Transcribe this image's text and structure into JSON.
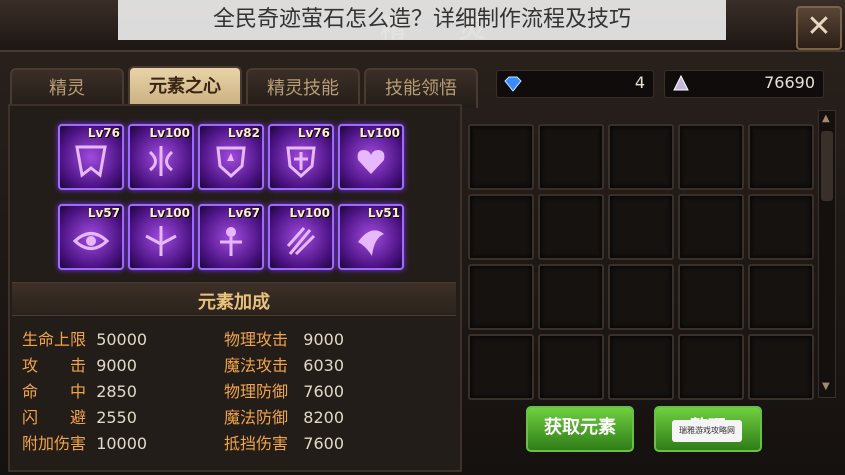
{
  "window": {
    "title": "精 灵"
  },
  "overlay_caption": "全民奇迹萤石怎么造？详细制作流程及技巧",
  "close_label": "✕",
  "tabs": [
    "精灵",
    "元素之心",
    "精灵技能",
    "技能领悟"
  ],
  "active_tab": "元素之心",
  "currency": {
    "diamond": "4",
    "crystal": "76690"
  },
  "elements": {
    "row1": [
      "Lv76",
      "Lv100",
      "Lv82",
      "Lv76",
      "Lv100"
    ],
    "row2": [
      "Lv57",
      "Lv100",
      "Lv67",
      "Lv100",
      "Lv51"
    ]
  },
  "section_title": "元素加成",
  "stats_left": [
    {
      "k": "生命上限",
      "v": "50000"
    },
    {
      "k": "攻　　击",
      "v": "9000"
    },
    {
      "k": "命　　中",
      "v": "2850"
    },
    {
      "k": "闪　　避",
      "v": "2550"
    },
    {
      "k": "附加伤害",
      "v": "10000"
    }
  ],
  "stats_right": [
    {
      "k": "物理攻击",
      "v": "9000"
    },
    {
      "k": "魔法攻击",
      "v": "6030"
    },
    {
      "k": "物理防御",
      "v": "7600"
    },
    {
      "k": "魔法防御",
      "v": "8200"
    },
    {
      "k": "抵挡伤害",
      "v": "7600"
    }
  ],
  "buttons": {
    "get_elements": "获取元素",
    "arrange": "整理"
  },
  "watermark": "瑞雅游戏攻略网",
  "colors": {
    "accent": "#e8c27a",
    "stat_key": "#f0a44a",
    "element_border": "#9e6bff",
    "button_green": "#4aa12b"
  }
}
